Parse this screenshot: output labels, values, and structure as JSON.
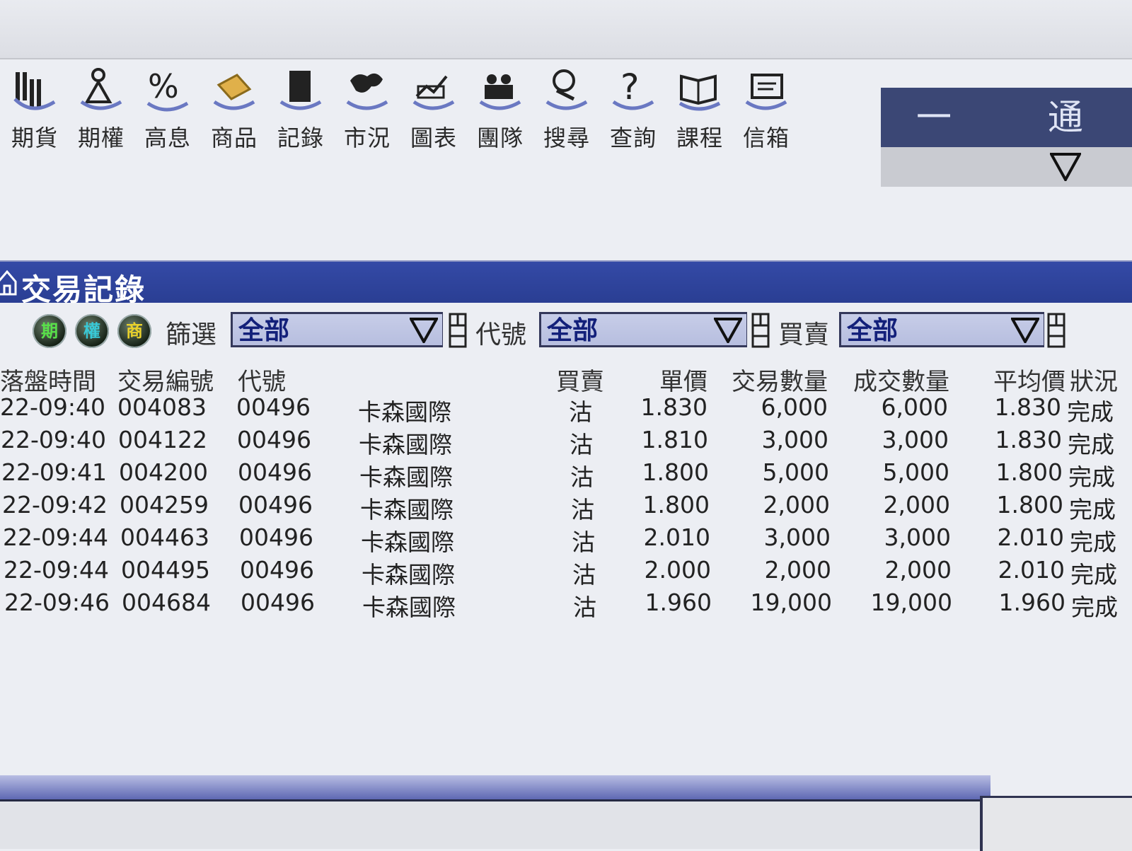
{
  "toolbar": {
    "items": [
      {
        "label": "期貨",
        "icon": "futures-icon"
      },
      {
        "label": "期權",
        "icon": "options-icon"
      },
      {
        "label": "高息",
        "icon": "high-yield-icon"
      },
      {
        "label": "商品",
        "icon": "commodity-icon"
      },
      {
        "label": "記錄",
        "icon": "records-icon"
      },
      {
        "label": "市況",
        "icon": "market-icon"
      },
      {
        "label": "圖表",
        "icon": "chart-icon"
      },
      {
        "label": "團隊",
        "icon": "team-icon"
      },
      {
        "label": "搜尋",
        "icon": "search-icon"
      },
      {
        "label": "查詢",
        "icon": "query-icon"
      },
      {
        "label": "課程",
        "icon": "course-icon"
      },
      {
        "label": "信箱",
        "icon": "mailbox-icon"
      }
    ]
  },
  "banner": {
    "text": "一 通 排 名"
  },
  "section": {
    "title": "交易記錄"
  },
  "filters": {
    "circles": [
      "期",
      "權",
      "商"
    ],
    "filter_label": "篩選",
    "filter_value": "全部",
    "code_label": "代號",
    "code_value": "全部",
    "side_label": "買賣",
    "side_value": "全部"
  },
  "table": {
    "headers": {
      "time": "落盤時間",
      "trade_no": "交易編號",
      "code": "代號",
      "side": "買賣",
      "price": "單價",
      "qty": "交易數量",
      "filled": "成交數量",
      "avg": "平均價",
      "status": "狀況"
    },
    "rows": [
      {
        "time": "22-09:40",
        "trade_no": "004083",
        "code": "00496",
        "name": "卡森國際",
        "side": "沽",
        "price": "1.830",
        "qty": "6,000",
        "filled": "6,000",
        "avg": "1.830",
        "status": "完成"
      },
      {
        "time": "22-09:40",
        "trade_no": "004122",
        "code": "00496",
        "name": "卡森國際",
        "side": "沽",
        "price": "1.810",
        "qty": "3,000",
        "filled": "3,000",
        "avg": "1.830",
        "status": "完成"
      },
      {
        "time": "22-09:41",
        "trade_no": "004200",
        "code": "00496",
        "name": "卡森國際",
        "side": "沽",
        "price": "1.800",
        "qty": "5,000",
        "filled": "5,000",
        "avg": "1.800",
        "status": "完成"
      },
      {
        "time": "22-09:42",
        "trade_no": "004259",
        "code": "00496",
        "name": "卡森國際",
        "side": "沽",
        "price": "1.800",
        "qty": "2,000",
        "filled": "2,000",
        "avg": "1.800",
        "status": "完成"
      },
      {
        "time": "22-09:44",
        "trade_no": "004463",
        "code": "00496",
        "name": "卡森國際",
        "side": "沽",
        "price": "2.010",
        "qty": "3,000",
        "filled": "3,000",
        "avg": "2.010",
        "status": "完成"
      },
      {
        "time": "22-09:44",
        "trade_no": "004495",
        "code": "00496",
        "name": "卡森國際",
        "side": "沽",
        "price": "2.000",
        "qty": "2,000",
        "filled": "2,000",
        "avg": "2.010",
        "status": "完成"
      },
      {
        "time": "22-09:46",
        "trade_no": "004684",
        "code": "00496",
        "name": "卡森國際",
        "side": "沽",
        "price": "1.960",
        "qty": "19,000",
        "filled": "19,000",
        "avg": "1.960",
        "status": "完成"
      }
    ]
  },
  "colors": {
    "header_bar": "#2f44a0",
    "select_bg": "#bcc3e3",
    "select_text": "#13207a",
    "banner_bg": "#3b4775"
  }
}
